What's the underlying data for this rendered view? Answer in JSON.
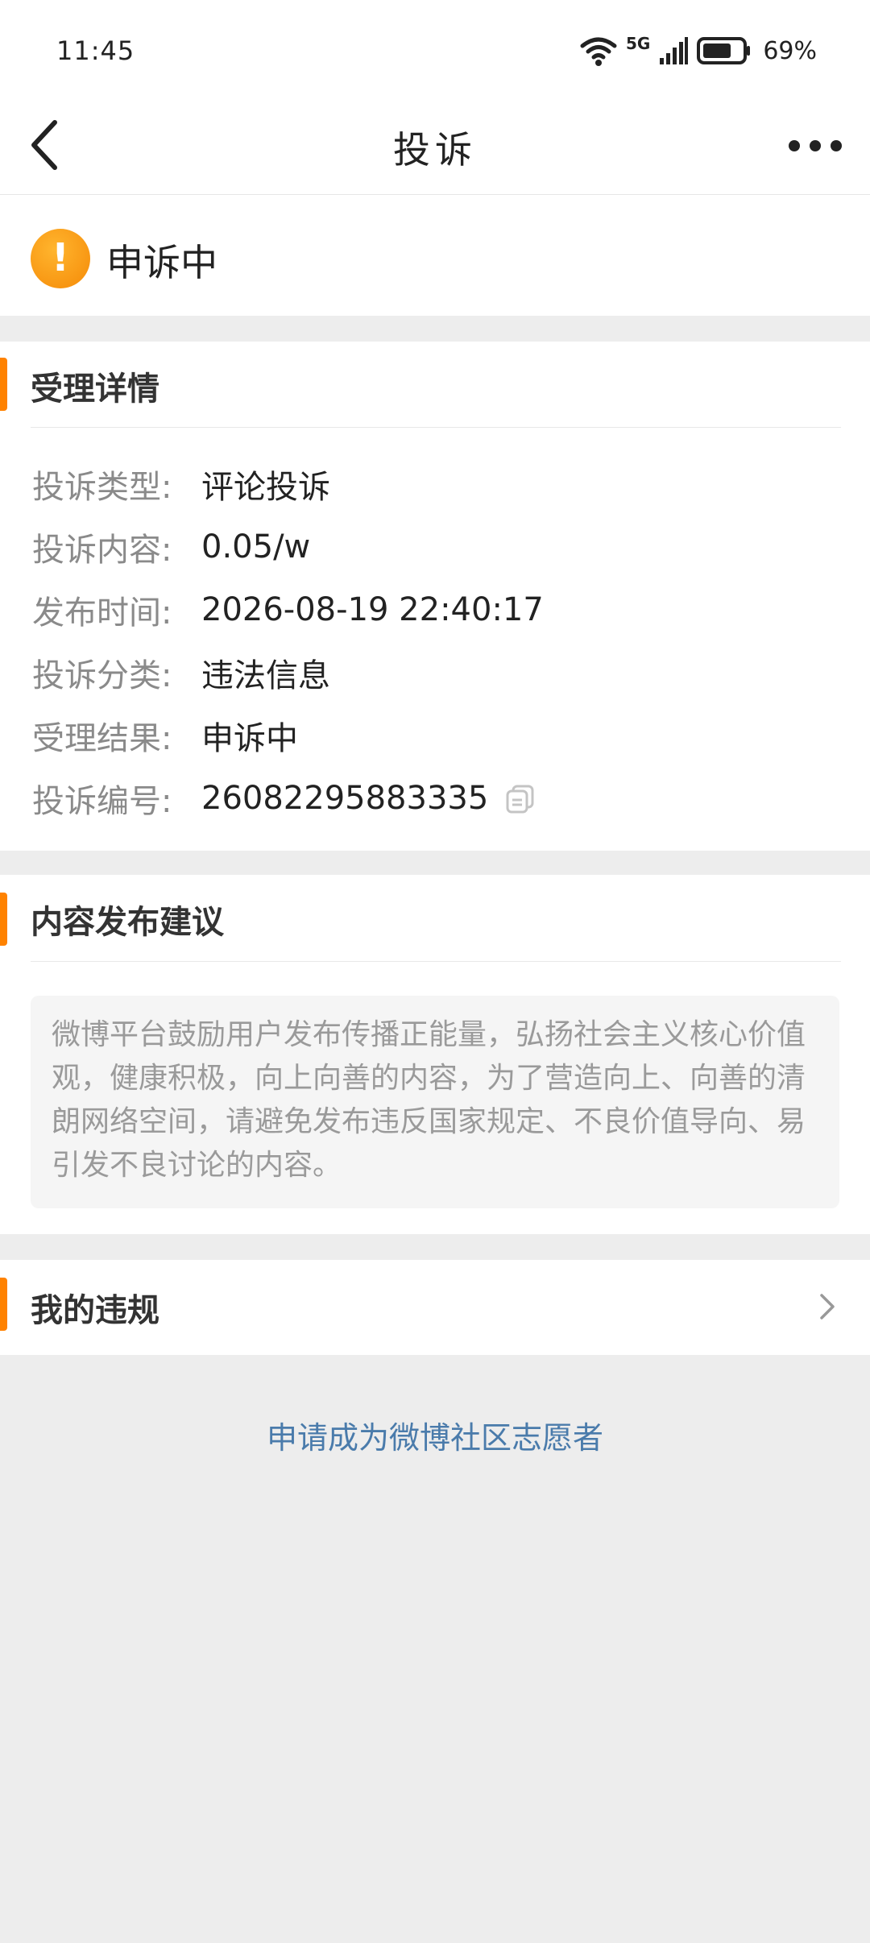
{
  "status_bar": {
    "time": "11:45",
    "network": "5G",
    "battery": "69%",
    "icons": [
      "wifi-icon",
      "signal-icon",
      "battery-icon"
    ]
  },
  "nav": {
    "title": "投诉",
    "back_icon": "back-arrow-icon",
    "more_icon": "more-dots-icon"
  },
  "status": {
    "icon": "warning-icon",
    "icon_glyph": "!",
    "text": "申诉中"
  },
  "details": {
    "title": "受理详情",
    "rows": [
      {
        "label": "投诉类型:",
        "value": "评论投诉"
      },
      {
        "label": "投诉内容:",
        "value": "0.05/w"
      },
      {
        "label": "发布时间:",
        "value": "2026-08-19 22:40:17"
      },
      {
        "label": "投诉分类:",
        "value": "违法信息"
      },
      {
        "label": "受理结果:",
        "value": "申诉中"
      },
      {
        "label": "投诉编号:",
        "value": "26082295883335"
      }
    ]
  },
  "advice": {
    "title": "内容发布建议",
    "text": "微博平台鼓励用户发布传播正能量，弘扬社会主义核心价值观，健康积极，向上向善的内容，为了营造向上、向善的清朗网络空间，请避免发布违反国家规定、不良价值导向、易引发不良讨论的内容。"
  },
  "violations": {
    "title": "我的违规"
  },
  "volunteer_link": "申请成为微博社区志愿者",
  "colors": {
    "accent": "#ff8200",
    "link": "#4a7bab",
    "background": "#ededed"
  }
}
